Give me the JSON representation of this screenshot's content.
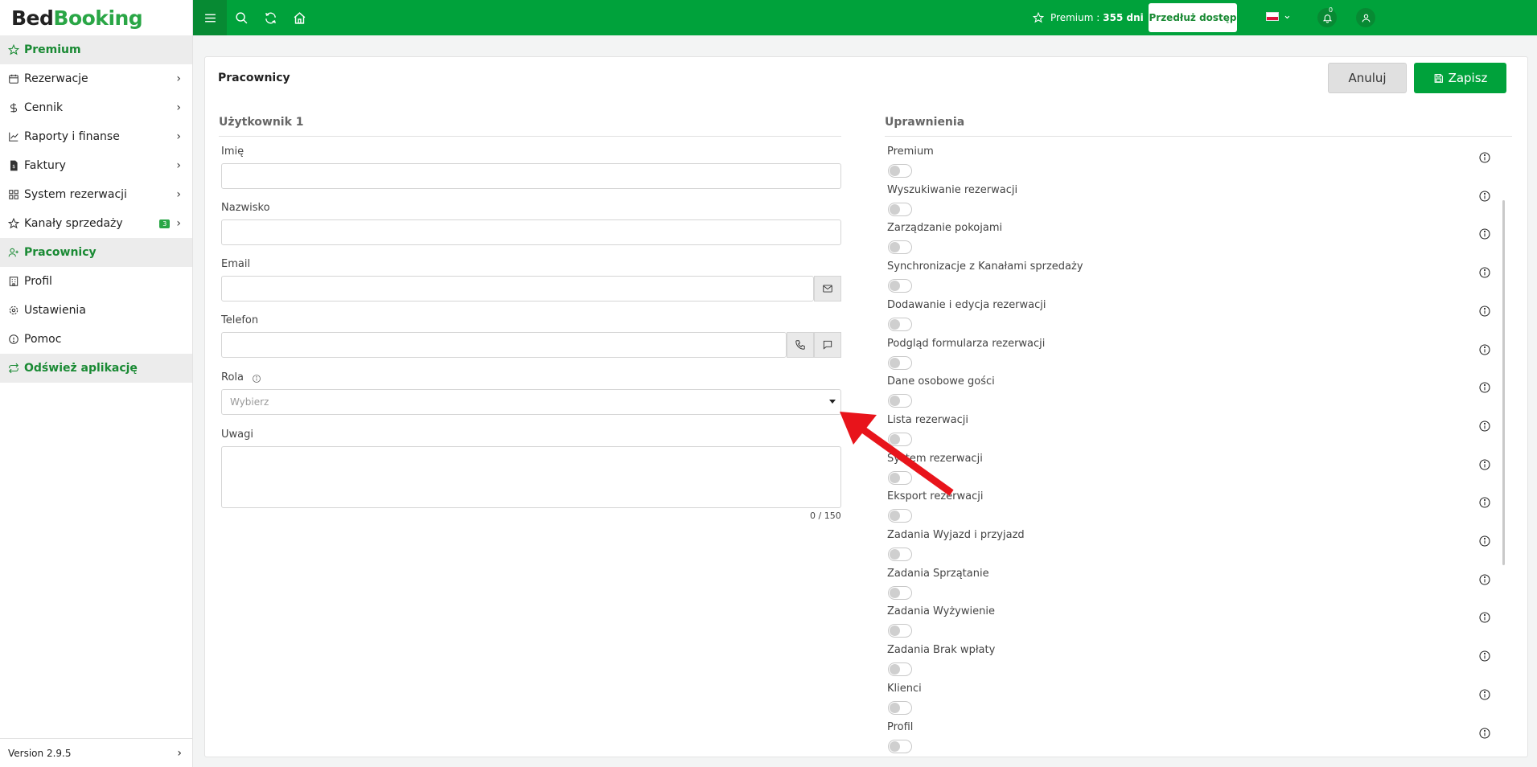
{
  "logo": {
    "part1": "Bed",
    "part2": "Booking"
  },
  "sidebar": {
    "items": [
      {
        "label": "Premium",
        "icon": "star-icon",
        "chevron": false
      },
      {
        "label": "Rezerwacje",
        "icon": "calendar-icon",
        "chevron": true
      },
      {
        "label": "Cennik",
        "icon": "dollar-icon",
        "chevron": true
      },
      {
        "label": "Raporty i finanse",
        "icon": "chart-icon",
        "chevron": true
      },
      {
        "label": "Faktury",
        "icon": "invoice-icon",
        "chevron": true
      },
      {
        "label": "System rezerwacji",
        "icon": "grid-icon",
        "chevron": true
      },
      {
        "label": "Kanały sprzedaży",
        "icon": "star-icon",
        "chevron": true,
        "badge": "3"
      },
      {
        "label": "Pracownicy",
        "icon": "users-icon",
        "chevron": false
      },
      {
        "label": "Profil",
        "icon": "building-icon",
        "chevron": false
      },
      {
        "label": "Ustawienia",
        "icon": "gear-icon",
        "chevron": false
      },
      {
        "label": "Pomoc",
        "icon": "help-icon",
        "chevron": false
      },
      {
        "label": "Odśwież aplikację",
        "icon": "refresh-icon",
        "chevron": false
      }
    ],
    "version": "Version 2.9.5"
  },
  "topbar": {
    "premium_label": "Premium :",
    "premium_days": "355 dni",
    "extend_button": "Przedłuż dostęp",
    "notification_count": "0"
  },
  "page": {
    "title": "Pracownicy",
    "cancel_label": "Anuluj",
    "save_label": "Zapisz"
  },
  "form": {
    "section_title": "Użytkownik 1",
    "first_name_label": "Imię",
    "first_name_value": "",
    "last_name_label": "Nazwisko",
    "last_name_value": "",
    "email_label": "Email",
    "email_value": "",
    "phone_label": "Telefon",
    "phone_value": "",
    "role_label": "Rola",
    "role_placeholder": "Wybierz",
    "notes_label": "Uwagi",
    "notes_counter": "0 / 150"
  },
  "permissions": {
    "section_title": "Uprawnienia",
    "items": [
      "Premium",
      "Wyszukiwanie rezerwacji",
      "Zarządzanie pokojami",
      "Synchronizacje z Kanałami sprzedaży",
      "Dodawanie i edycja rezerwacji",
      "Podgląd formularza rezerwacji",
      "Dane osobowe gości",
      "Lista rezerwacji",
      "System rezerwacji",
      "Eksport rezerwacji",
      "Zadania Wyjazd i przyjazd",
      "Zadania Sprzątanie",
      "Zadania Wyżywienie",
      "Zadania Brak wpłaty",
      "Klienci",
      "Profil"
    ]
  },
  "colors": {
    "brand": "#00a23b",
    "accent": "#1a8a34",
    "annotation_arrow": "#e8141b"
  }
}
